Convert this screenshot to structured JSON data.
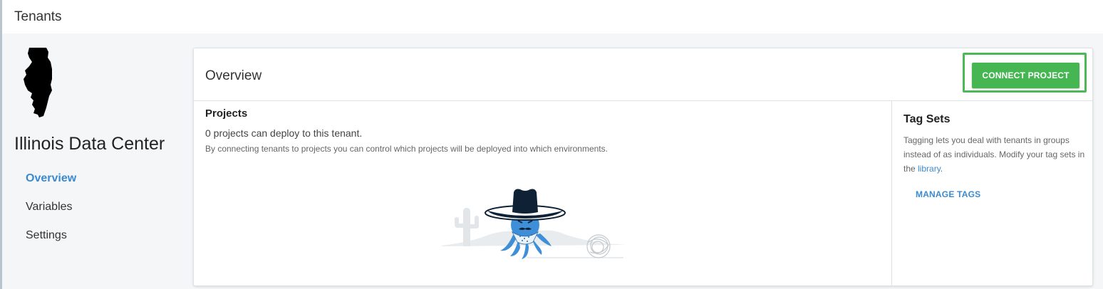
{
  "header": {
    "title": "Tenants"
  },
  "sidebar": {
    "tenant_name": "Illinois Data Center",
    "logo_icon": "illinois-state-icon",
    "nav": [
      {
        "label": "Overview",
        "active": true
      },
      {
        "label": "Variables",
        "active": false
      },
      {
        "label": "Settings",
        "active": false
      }
    ]
  },
  "card": {
    "title": "Overview",
    "connect_button": "CONNECT PROJECT",
    "projects": {
      "heading": "Projects",
      "count_text": "0 projects can deploy to this tenant.",
      "description": "By connecting tenants to projects you can control which projects will be deployed into which environments.",
      "illustration_icon": "octopus-cowboy-icon"
    },
    "tag_sets": {
      "heading": "Tag Sets",
      "text_before": "Tagging lets you deal with tenants in groups instead of as individuals. Modify your tag sets in the ",
      "link": "library",
      "text_after": ".",
      "manage_button": "MANAGE TAGS"
    }
  },
  "colors": {
    "accent_blue": "#3b8ad0",
    "button_green": "#46b653",
    "highlight_green": "#4cb856",
    "background": "#f4f6f8"
  }
}
